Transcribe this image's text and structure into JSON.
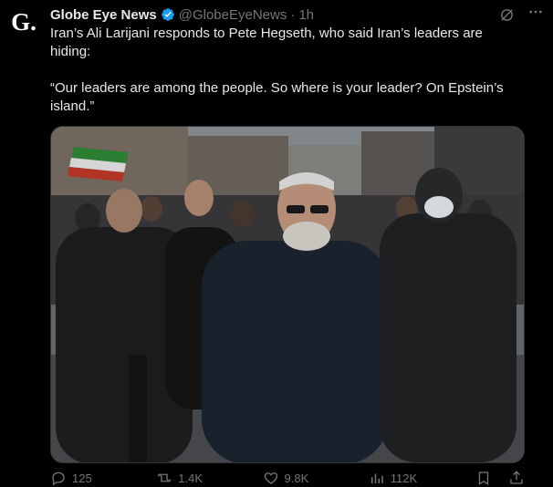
{
  "account": {
    "avatar_letter": "G.",
    "name": "Globe Eye News",
    "handle": "@GlobeEyeNews",
    "separator": "·",
    "time": "1h",
    "verified": true
  },
  "tweet": {
    "line1": "Iran’s Ali Larijani responds to Pete Hegseth, who said Iran’s leaders are hiding:",
    "line2": "“Our leaders are among the people. So where is your leader? On Epstein’s island.”"
  },
  "actions": {
    "replies": "125",
    "reposts": "1.4K",
    "likes": "9.8K",
    "views": "112K"
  },
  "icons": {
    "grok": "grok-icon",
    "more": "more-icon",
    "reply": "reply-icon",
    "repost": "repost-icon",
    "like": "heart-icon",
    "views": "views-icon",
    "bookmark": "bookmark-icon",
    "share": "share-icon"
  },
  "colors": {
    "background": "#000000",
    "text": "#e7e9ea",
    "muted": "#71767b",
    "verified": "#1d9bf0"
  }
}
